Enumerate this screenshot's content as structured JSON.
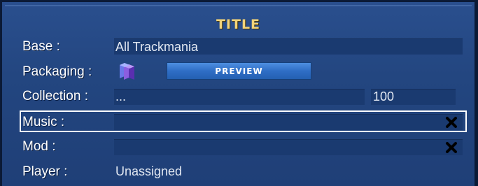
{
  "title": "TITLE",
  "rows": {
    "base": {
      "label": "Base :",
      "value": "All Trackmania"
    },
    "packaging": {
      "label": "Packaging :",
      "icon": "cube-package-icon",
      "button_label": "PREVIEW"
    },
    "collection": {
      "label": "Collection :",
      "value": "...",
      "count": "100"
    },
    "music": {
      "label": "Music :",
      "value": "",
      "clear_icon": "close-icon"
    },
    "mod": {
      "label": "Mod :",
      "value": "",
      "clear_icon": "close-icon"
    },
    "player": {
      "label": "Player :",
      "value": "Unassigned"
    }
  },
  "colors": {
    "panel_bg": "#234680",
    "field_bg": "#1a3a70",
    "title": "#f2d47a",
    "button": "#3a7ad4",
    "highlight_border": "#ffffff"
  }
}
